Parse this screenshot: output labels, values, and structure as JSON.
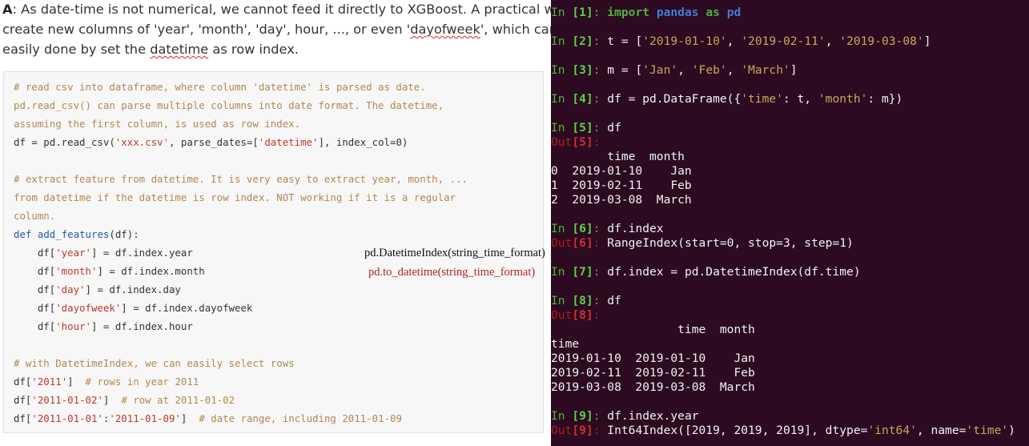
{
  "answer": {
    "label": "A",
    "line1": ": As date-time is not numerical, we cannot feed it directly to XGBoost. A practical way is to",
    "line2_a": "create new columns of 'year', 'month', 'day', hour, ..., or even '",
    "line2_b": "dayofweek",
    "line2_c": "', which can be",
    "line3_a": "easily done by set the ",
    "line3_b": "datetime",
    "line3_c": " as row index."
  },
  "code": {
    "l1": "# read csv into dataframe, where column 'datetime' is parsed as date.",
    "l2": "pd.read_csv() can parse multiple columns into date format. The datetime,",
    "l3": "assuming the first column, is used as row index.",
    "l4_a": "df = pd.read_csv(",
    "l4_b": "'xxx.csv'",
    "l4_c": ", parse_dates=[",
    "l4_d": "'datetime'",
    "l4_e": "], index_col=0)",
    "l5": "# extract feature from datetime. It is very easy to extract year, month, ...",
    "l6": "from datetime if the datetime is row index. NOT working if it is a regular",
    "l7": "column.",
    "l8_kw": "def",
    "l8_fn": "add_features",
    "l8_rest": "(df):",
    "f1_a": "    df[",
    "f1_b": "'year'",
    "f1_c": "] = df.index.year",
    "f2_a": "    df[",
    "f2_b": "'month'",
    "f2_c": "] = df.index.month",
    "f3_a": "    df[",
    "f3_b": "'day'",
    "f3_c": "] = df.index.day",
    "f4_a": "    df[",
    "f4_b": "'dayofweek'",
    "f4_c": "] = df.index.dayofweek",
    "f5_a": "    df[",
    "f5_b": "'hour'",
    "f5_c": "] = df.index.hour",
    "l9": "# with DatetimeIndex, we can easily select rows",
    "s1_a": "df[",
    "s1_b": "'2011'",
    "s1_c": "]  ",
    "s1_d": "# rows in year 2011",
    "s2_a": "df[",
    "s2_b": "'2011-01-02'",
    "s2_c": "]  ",
    "s2_d": "# row at 2011-01-02",
    "s3_a": "df[",
    "s3_b": "'2011-01-01'",
    "s3_c": ":",
    "s3_d": "'2011-01-09'",
    "s3_e": "]  ",
    "s3_f": "# date range, including 2011-01-09"
  },
  "annotations": {
    "a1": "pd.DatetimeIndex(string_time_format)",
    "a2": "pd.to_datetime(string_time_format)"
  },
  "terminal": {
    "in_label": "In ",
    "out_label": "Out",
    "c1": {
      "num": "[1]",
      "kw1": "import",
      "mod": "pandas",
      "kw2": "as",
      "alias": "pd"
    },
    "c2": {
      "num": "[2]",
      "a": "t = [",
      "s1": "'2019-01-10'",
      "s2": "'2019-02-11'",
      "s3": "'2019-03-08'",
      "end": "]"
    },
    "c3": {
      "num": "[3]",
      "a": "m = [",
      "s1": "'Jan'",
      "s2": "'Feb'",
      "s3": "'March'",
      "end": "]"
    },
    "c4": {
      "num": "[4]",
      "a": "df = pd.DataFrame({",
      "s1": "'time'",
      "b": ": t, ",
      "s2": "'month'",
      "c": ": m})"
    },
    "c5": {
      "num": "[5]",
      "code": "df",
      "outnum": "[5]",
      "rows": [
        "        time  month",
        "0  2019-01-10    Jan",
        "1  2019-02-11    Feb",
        "2  2019-03-08  March"
      ]
    },
    "c6": {
      "num": "[6]",
      "code": "df.index",
      "outnum": "[6]",
      "out": "RangeIndex(start=0, stop=3, step=1)"
    },
    "c7": {
      "num": "[7]",
      "code": "df.index = pd.DatetimeIndex(df.time)"
    },
    "c8": {
      "num": "[8]",
      "code": "df",
      "outnum": "[8]",
      "rows": [
        "                  time  month",
        "time",
        "2019-01-10  2019-01-10    Jan",
        "2019-02-11  2019-02-11    Feb",
        "2019-03-08  2019-03-08  March"
      ]
    },
    "c9": {
      "num": "[9]",
      "code": "df.index.year",
      "outnum": "[9]",
      "out_a": "Int64Index([2019, 2019, 2019], dtype=",
      "out_s1": "'int64'",
      "out_b": ", name=",
      "out_s2": "'time'",
      "out_c": ")"
    }
  },
  "colors": {
    "terminal_bg": "#2c0a22",
    "prompt_green": "#4fb33a",
    "out_red": "#b31d1d",
    "code_string": "#c0392b",
    "code_comment": "#b08850"
  }
}
